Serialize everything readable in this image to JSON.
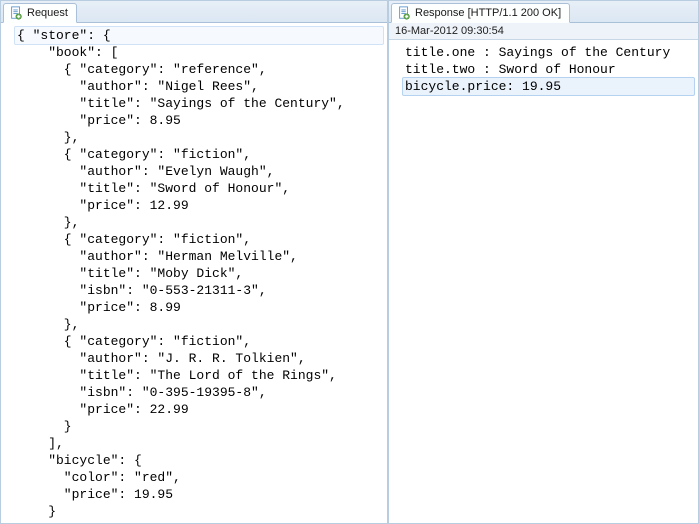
{
  "left": {
    "tab_label": "Request",
    "code_lines": [
      {
        "text": "{ \"store\": {",
        "sel": 1
      },
      {
        "text": "    \"book\": [",
        "sel": 0
      },
      {
        "text": "      { \"category\": \"reference\",",
        "sel": 0
      },
      {
        "text": "        \"author\": \"Nigel Rees\",",
        "sel": 0
      },
      {
        "text": "        \"title\": \"Sayings of the Century\",",
        "sel": 0
      },
      {
        "text": "        \"price\": 8.95",
        "sel": 0
      },
      {
        "text": "      },",
        "sel": 0
      },
      {
        "text": "      { \"category\": \"fiction\",",
        "sel": 0
      },
      {
        "text": "        \"author\": \"Evelyn Waugh\",",
        "sel": 0
      },
      {
        "text": "        \"title\": \"Sword of Honour\",",
        "sel": 0
      },
      {
        "text": "        \"price\": 12.99",
        "sel": 0
      },
      {
        "text": "      },",
        "sel": 0
      },
      {
        "text": "      { \"category\": \"fiction\",",
        "sel": 0
      },
      {
        "text": "        \"author\": \"Herman Melville\",",
        "sel": 0
      },
      {
        "text": "        \"title\": \"Moby Dick\",",
        "sel": 0
      },
      {
        "text": "        \"isbn\": \"0-553-21311-3\",",
        "sel": 0
      },
      {
        "text": "        \"price\": 8.99",
        "sel": 0
      },
      {
        "text": "      },",
        "sel": 0
      },
      {
        "text": "      { \"category\": \"fiction\",",
        "sel": 0
      },
      {
        "text": "        \"author\": \"J. R. R. Tolkien\",",
        "sel": 0
      },
      {
        "text": "        \"title\": \"The Lord of the Rings\",",
        "sel": 0
      },
      {
        "text": "        \"isbn\": \"0-395-19395-8\",",
        "sel": 0
      },
      {
        "text": "        \"price\": 22.99",
        "sel": 0
      },
      {
        "text": "      }",
        "sel": 0
      },
      {
        "text": "    ],",
        "sel": 0
      },
      {
        "text": "    \"bicycle\": {",
        "sel": 0
      },
      {
        "text": "      \"color\": \"red\",",
        "sel": 0
      },
      {
        "text": "      \"price\": 19.95",
        "sel": 0
      },
      {
        "text": "    }",
        "sel": 0
      }
    ]
  },
  "right": {
    "tab_label": "Response [HTTP/1.1 200 OK]",
    "timestamp": "16-Mar-2012 09:30:54",
    "code_lines": [
      {
        "text": "title.one : Sayings of the Century",
        "sel": 0
      },
      {
        "text": "title.two : Sword of Honour",
        "sel": 0
      },
      {
        "text": "bicycle.price: 19.95",
        "sel": 2
      }
    ]
  }
}
